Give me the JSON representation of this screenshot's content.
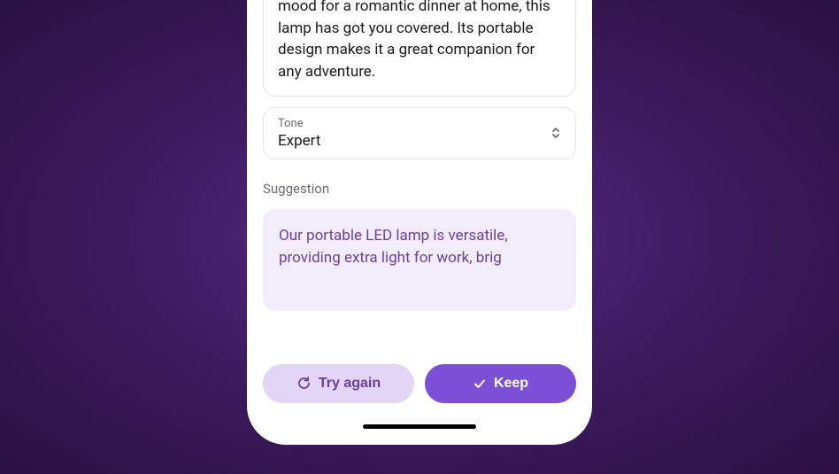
{
  "description_card": {
    "text": "mood for a romantic dinner at home, this lamp has got you covered. Its portable design makes it a great companion for any adventure."
  },
  "tone_selector": {
    "label": "Tone",
    "value": "Expert"
  },
  "suggestion": {
    "label": "Suggestion",
    "text": "Our portable LED lamp is versatile, providing extra light for work, brig"
  },
  "actions": {
    "try_again_label": "Try again",
    "keep_label": "Keep"
  },
  "colors": {
    "accent": "#7b4fd6",
    "secondary_bg": "#e3d5f5",
    "suggestion_bg": "#f3ecfb",
    "suggestion_text": "#6b3fa0"
  }
}
